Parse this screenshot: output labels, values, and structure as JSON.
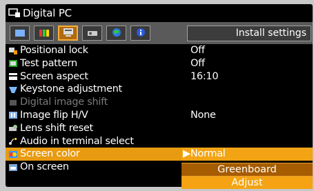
{
  "header": {
    "title": "Digital PC",
    "right_label": "Install settings"
  },
  "tabs": [
    {
      "icon": "image-adjust-icon"
    },
    {
      "icon": "color-bars-icon"
    },
    {
      "icon": "install-icon",
      "active": true
    },
    {
      "icon": "projector-icon"
    },
    {
      "icon": "globe-icon"
    },
    {
      "icon": "info-icon"
    }
  ],
  "menu": {
    "items": [
      {
        "label": "Positional lock",
        "value": "Off",
        "icon": "lock-icon"
      },
      {
        "label": "Test pattern",
        "value": "Off",
        "icon": "test-pattern-icon"
      },
      {
        "label": "Screen aspect",
        "value": "16:10",
        "icon": "screen-aspect-icon"
      },
      {
        "label": "Keystone adjustment",
        "value": "",
        "icon": "keystone-icon"
      },
      {
        "label": "Digital image shift",
        "value": "",
        "icon": "image-shift-icon",
        "disabled": true
      },
      {
        "label": "Image flip H/V",
        "value": "None",
        "icon": "flip-icon"
      },
      {
        "label": "Lens shift reset",
        "value": "",
        "icon": "lens-shift-icon"
      },
      {
        "label": "Audio in terminal select",
        "value": "",
        "icon": "audio-icon"
      },
      {
        "label": "Screen color",
        "value": "▶Normal",
        "icon": "screen-color-icon",
        "selected": true
      },
      {
        "label": "On screen",
        "value": "",
        "icon": "on-screen-icon"
      }
    ]
  },
  "dropdown": {
    "options": [
      "Greenboard",
      "Adjust"
    ]
  }
}
